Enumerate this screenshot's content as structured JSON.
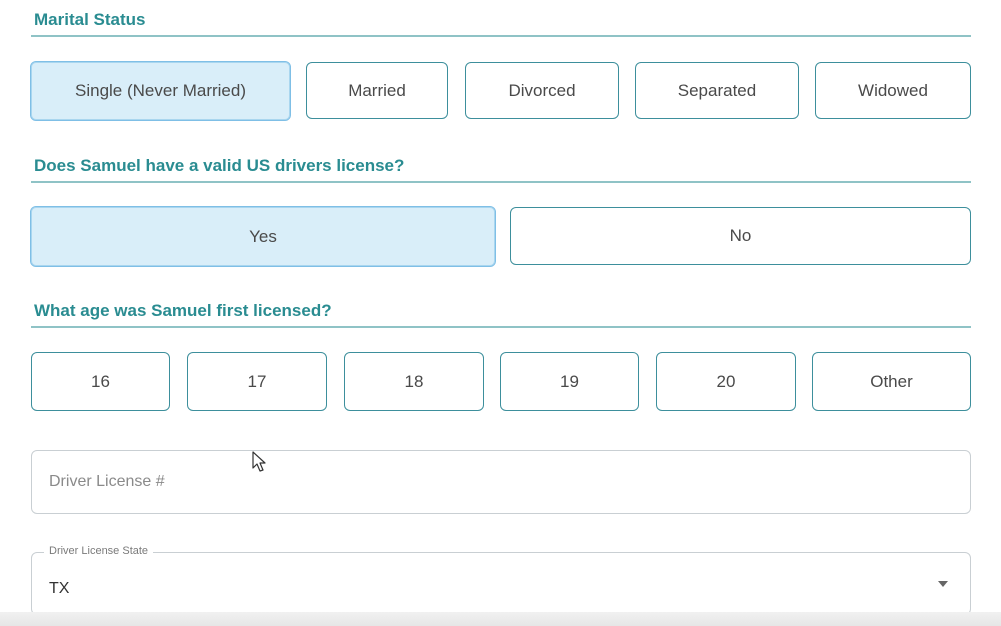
{
  "marital": {
    "title": "Marital Status",
    "options": [
      "Single (Never Married)",
      "Married",
      "Divorced",
      "Separated",
      "Widowed"
    ],
    "selected": "Single (Never Married)"
  },
  "license_valid": {
    "title": "Does Samuel have a valid US drivers license?",
    "options": [
      "Yes",
      "No"
    ],
    "selected": "Yes"
  },
  "first_licensed": {
    "title": "What age was Samuel first licensed?",
    "options": [
      "16",
      "17",
      "18",
      "19",
      "20",
      "Other"
    ]
  },
  "license_number": {
    "placeholder": "Driver License #"
  },
  "license_state": {
    "label": "Driver License State",
    "value": "TX",
    "icon": "chevron-down-icon"
  },
  "colors": {
    "accent": "#2a8c91",
    "selected_bg": "#d9eef9"
  }
}
